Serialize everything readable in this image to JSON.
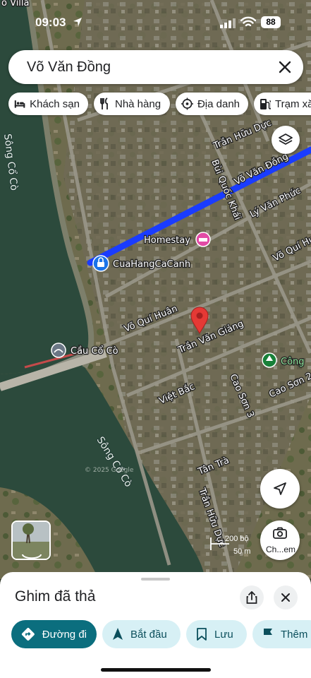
{
  "status_bar": {
    "time": "09:03",
    "battery": "88"
  },
  "search": {
    "query": "Võ Văn Đồng",
    "clear_icon": "close-icon"
  },
  "chips": [
    {
      "label": "Khách sạn",
      "icon": "hotel-icon"
    },
    {
      "label": "Nhà hàng",
      "icon": "restaurant-icon"
    },
    {
      "label": "Địa danh",
      "icon": "landmark-icon"
    },
    {
      "label": "Trạm xă",
      "icon": "gas-station-icon"
    }
  ],
  "map": {
    "top_edge_label": "o Villa",
    "roads": {
      "tran_huu_duc_top": "Trần Hữu Dực",
      "vo_van_dong": "Võ Văn Đồng",
      "bui_quoc_khai": "Bùi Quốc Khái",
      "ly_van_phuc": "Lý Văn Phức",
      "vo_qui_huan_right": "Võ Quí Hu",
      "vo_qui_huan": "Võ Quí Huân",
      "tran_van_giang": "Trần Văn Giảng",
      "viet_bac": "Việt Bắc",
      "cao_son_3": "Cao Sơn 3",
      "cao_son_2": "Cao Sơn 2",
      "tan_tra": "Tân Trà",
      "tran_huu_duc_bottom": "Trần Hữu Dực"
    },
    "rivers": {
      "left": "Sông Cổ Cò",
      "bottom": "Sông Cổ Cò"
    },
    "pois": {
      "homestay": "Homestay",
      "shop": "CuaHangCaCanh",
      "bridge": "Cầu Cổ Cò",
      "park": "Công"
    },
    "watermark": "© 2025 Google",
    "scale": {
      "imperial": "200 bộ",
      "metric": "50 m"
    },
    "camera_label": "Ch...em",
    "route_color": "#1a3cff",
    "pin_color": "#e53935"
  },
  "sheet": {
    "title": "Ghim đã thả",
    "share_icon": "share-icon",
    "close_icon": "close-icon",
    "actions": [
      {
        "label": "Đường đi",
        "icon": "directions-icon",
        "style": "primary"
      },
      {
        "label": "Bắt đầu",
        "icon": "navigation-arrow-icon",
        "style": "secondary"
      },
      {
        "label": "Lưu",
        "icon": "bookmark-icon",
        "style": "secondary"
      },
      {
        "label": "Thêm",
        "icon": "flag-icon",
        "style": "secondary"
      }
    ]
  }
}
